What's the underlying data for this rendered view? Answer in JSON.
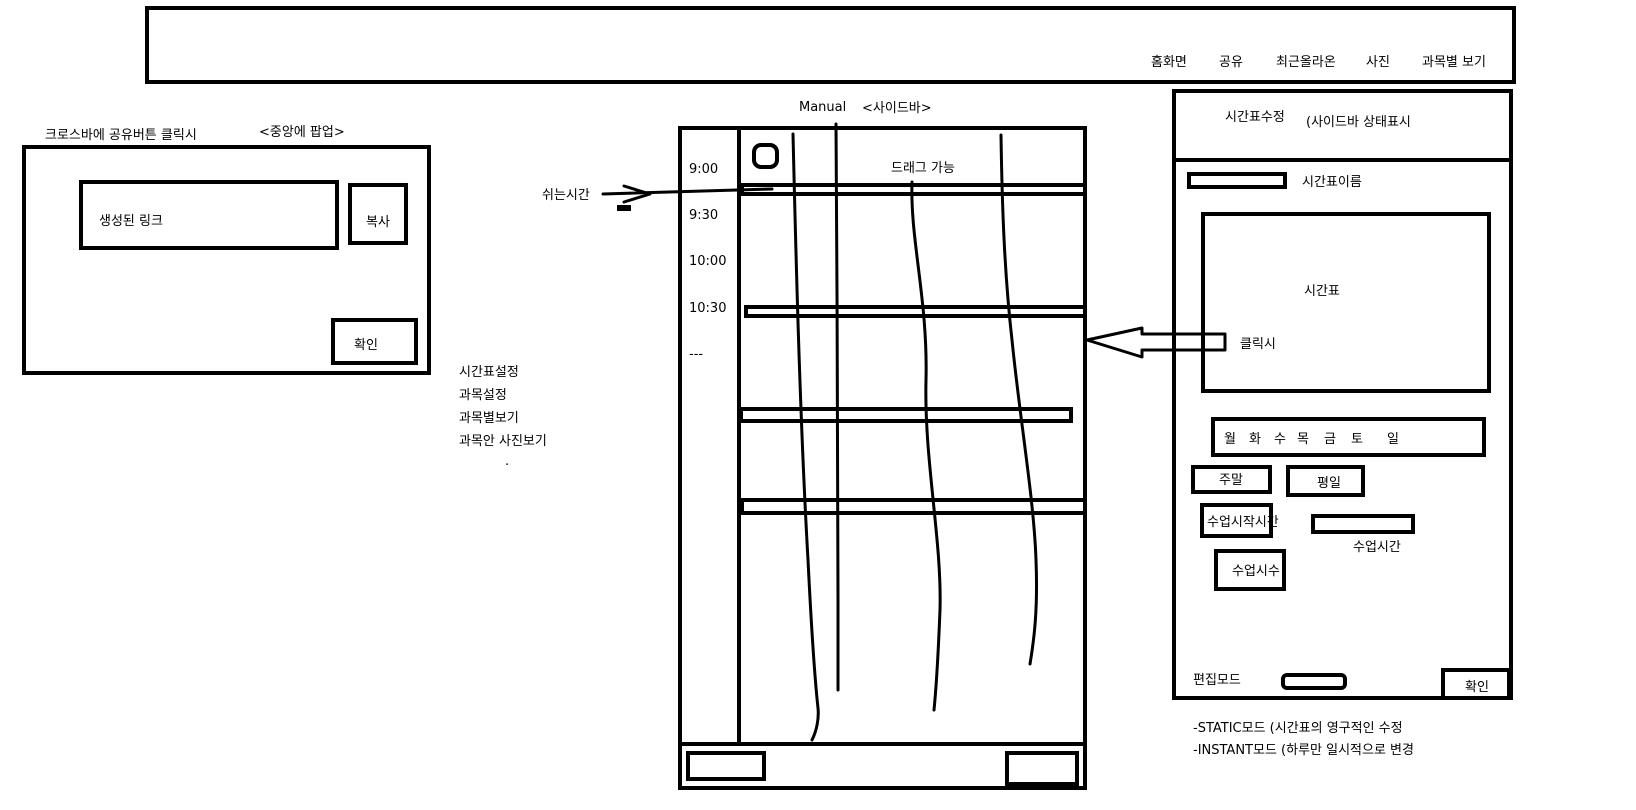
{
  "topbar": {
    "nav": [
      "홈화면",
      "공유",
      "최근올라온",
      "사진",
      "과목별 보기"
    ]
  },
  "share_popup": {
    "note_left": "크로스바에 공유버튼 클릭시",
    "note_right": "<중앙에 팝업>",
    "link_label": "생성된 링크",
    "copy_button": "복사",
    "confirm_button": "확인"
  },
  "menu": {
    "items": [
      "시간표설정",
      "과목설정",
      "과목별보기",
      "과목안 사진보기",
      "."
    ]
  },
  "timetable": {
    "header_manual": "Manual",
    "header_sidebar": "<사이드바>",
    "drag_label": "드래그 가능",
    "break_label": "쉬는시간",
    "times": [
      "9:00",
      "9:30",
      "10:00",
      "10:30",
      "---"
    ]
  },
  "editor": {
    "title": "시간표수정",
    "status": "(사이드바 상태표시",
    "name_label": "시간표이름",
    "preview_label": "시간표",
    "click_label": "클릭시",
    "days": [
      "월",
      "화",
      "수",
      "목",
      "금",
      "토",
      "일"
    ],
    "weekend_button": "주말",
    "weekday_button": "평일",
    "class_start_button": "수업시작시간",
    "class_time_label": "수업시간",
    "class_count_button": "수업시수",
    "edit_mode_label": "편집모드",
    "confirm_button": "확인",
    "notes": [
      "-STATIC모드 (시간표의 영구적인 수정",
      "-INSTANT모드 (하루만 일시적으로 변경"
    ]
  }
}
